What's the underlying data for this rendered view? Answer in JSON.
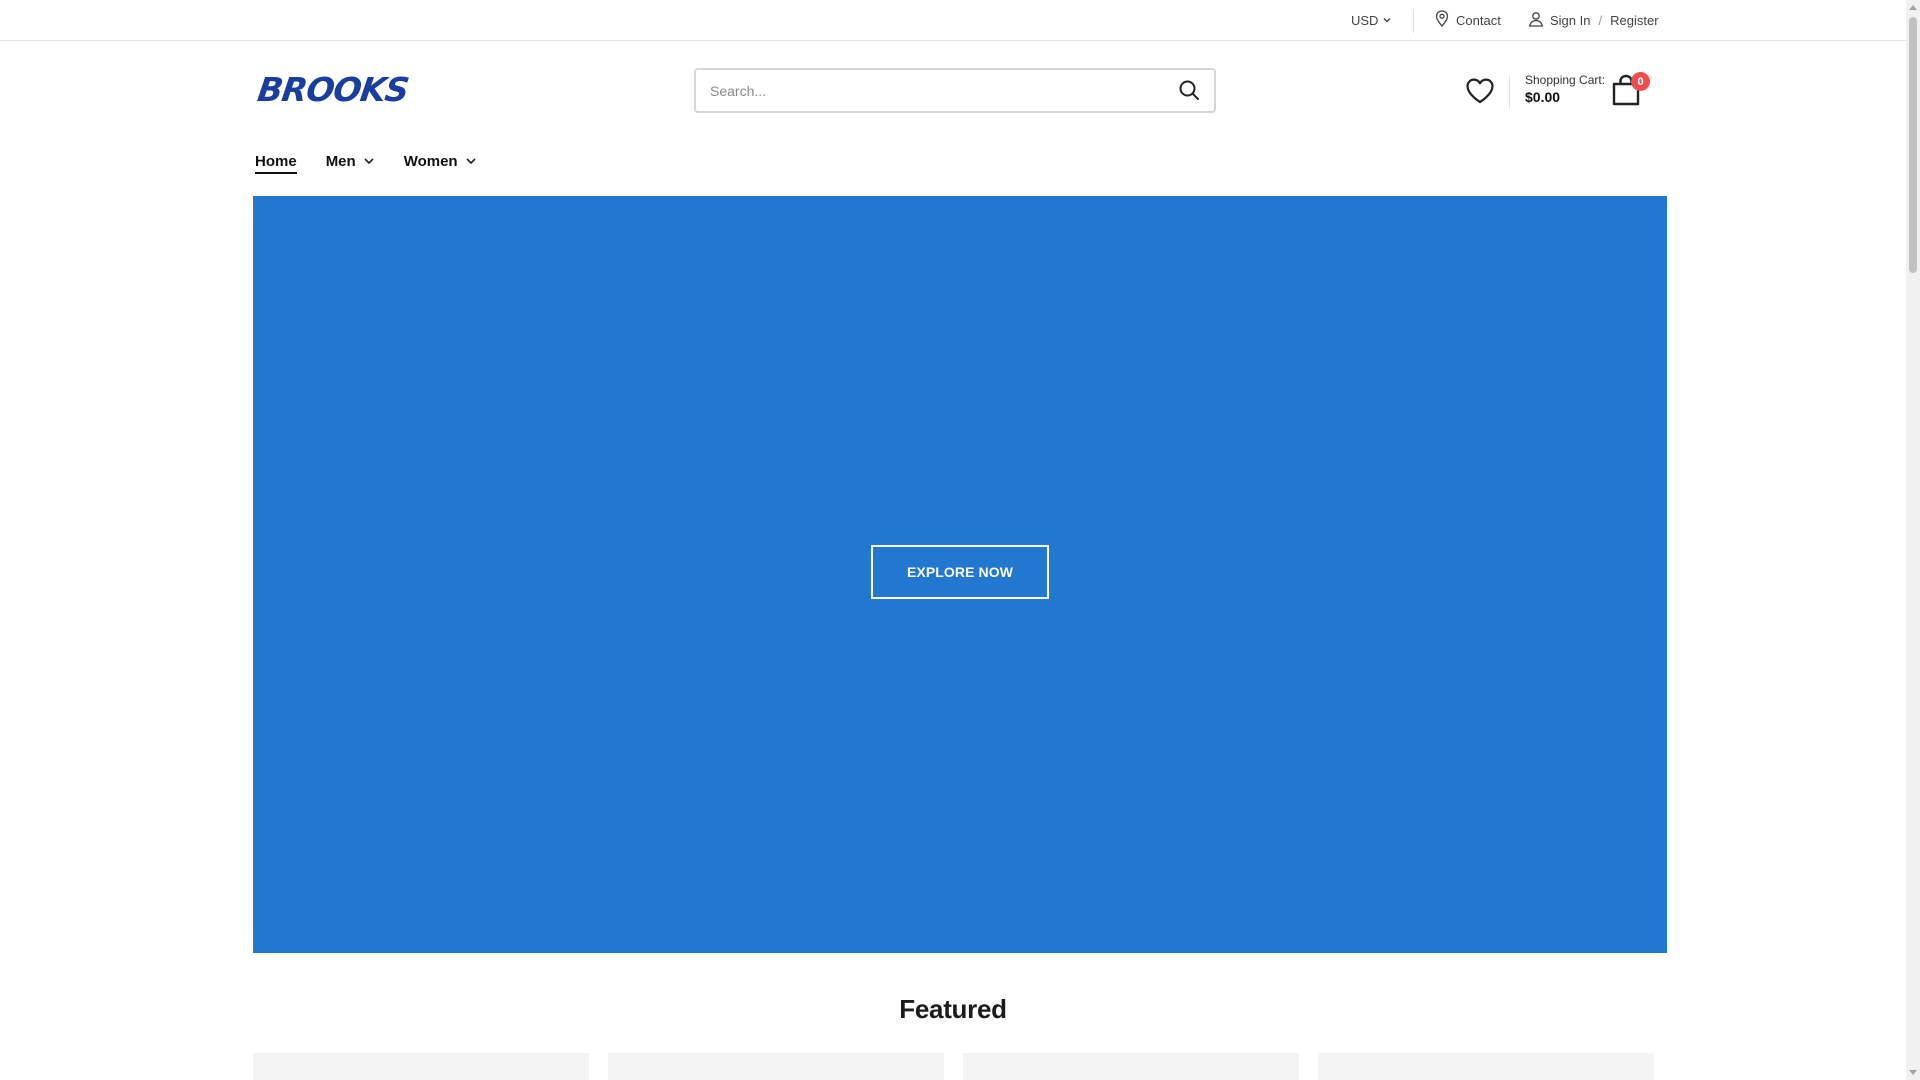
{
  "topbar": {
    "currency": "USD",
    "contact": "Contact",
    "sign_in": "Sign In",
    "separator": "/",
    "register": "Register",
    "icons": [
      "chevron-down-icon",
      "location-pin-icon",
      "user-icon"
    ]
  },
  "header": {
    "logo": "BROOKS",
    "search_placeholder": "Search...",
    "cart_label": "Shopping Cart:",
    "cart_total": "$0.00",
    "cart_count": "0",
    "icons": [
      "search-icon",
      "heart-icon",
      "shopping-bag-icon"
    ]
  },
  "nav": {
    "items": [
      {
        "label": "Home",
        "active": true,
        "has_dropdown": false
      },
      {
        "label": "Men",
        "active": false,
        "has_dropdown": true
      },
      {
        "label": "Women",
        "active": false,
        "has_dropdown": true
      }
    ]
  },
  "hero": {
    "button_label": "EXPLORE NOW",
    "background_color": "#2278cf"
  },
  "featured": {
    "title": "Featured"
  },
  "colors": {
    "brand": "#1a3ea0",
    "hero": "#2278cf",
    "badge": "#f04e4e"
  }
}
